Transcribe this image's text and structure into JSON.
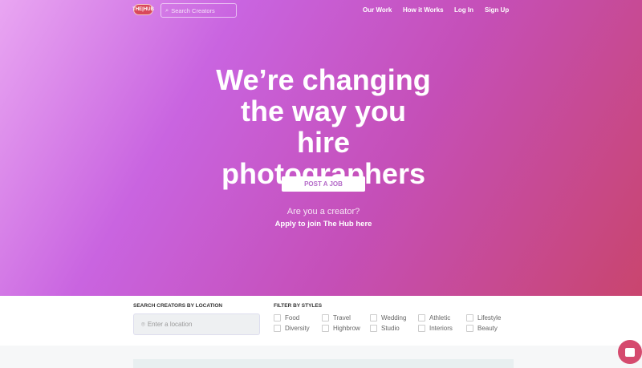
{
  "header": {
    "logo": "THE HUB",
    "search_placeholder": "Search Creators",
    "nav": [
      "Our Work",
      "How it Works",
      "Log In",
      "Sign Up"
    ]
  },
  "hero": {
    "title": "We’re changing the way you hire photographers",
    "cta": "POST A JOB",
    "question": "Are you a creator?",
    "apply": "Apply to join The Hub here"
  },
  "filters": {
    "location_label": "SEARCH CREATORS BY LOCATION",
    "location_placeholder": "Enter a location",
    "styles_label": "FILTER BY STYLES",
    "styles": [
      "Food",
      "Travel",
      "Wedding",
      "Athletic",
      "Lifestyle",
      "Diversity",
      "Highbrow",
      "Studio",
      "Interiors",
      "Beauty"
    ]
  }
}
